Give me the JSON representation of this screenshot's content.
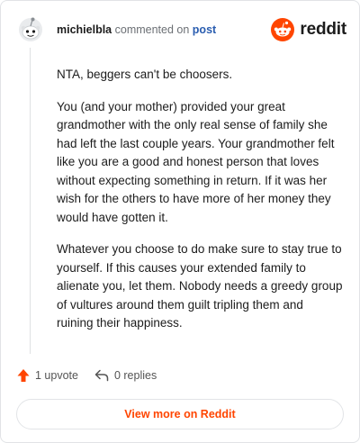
{
  "header": {
    "username": "michielbla",
    "action_text": "commented on",
    "post_link": "post",
    "logo_text": "reddit",
    "logo_icon": "reddit-alien-icon",
    "avatar_icon": "default-avatar-icon"
  },
  "comment": {
    "paragraphs": [
      "NTA, beggers can't be choosers.",
      "You (and your mother) provided your great grandmother with the only real sense of family she had left the last couple years. Your grandmother felt like you are a good and honest person that loves without expecting something in return. If it was her wish for the others to have more of her money they would have gotten it.",
      "Whatever you choose to do make sure to stay true to yourself. If this causes your extended family to alienate you, let them. Nobody needs a greedy group of vultures around them guilt tripling them and ruining their happiness."
    ]
  },
  "actions": {
    "upvote_label": "1 upvote",
    "replies_label": "0 replies",
    "upvote_icon": "upvote-arrow-icon",
    "reply_icon": "reply-arrow-icon"
  },
  "footer": {
    "view_more_label": "View more on Reddit"
  },
  "colors": {
    "brand": "#ff4500",
    "link": "#2a5db0",
    "text": "#1c1c1c",
    "muted": "#6b6f74"
  }
}
